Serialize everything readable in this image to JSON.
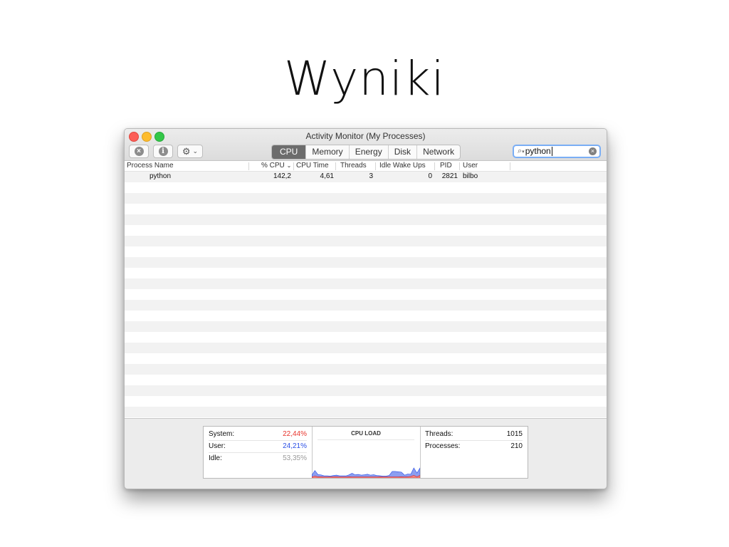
{
  "slide": {
    "title": "Wyniki"
  },
  "window": {
    "title": "Activity Monitor (My Processes)",
    "toolbar": {
      "stop_icon": "x-circle-icon",
      "info_icon": "info-icon",
      "gear_icon": "gear-icon",
      "tabs": [
        "CPU",
        "Memory",
        "Energy",
        "Disk",
        "Network"
      ],
      "active_tab": "CPU",
      "search_value": "python"
    },
    "table": {
      "headers": {
        "process_name": "Process Name",
        "cpu_pct": "% CPU",
        "cpu_time": "CPU Time",
        "threads": "Threads",
        "idle_wake_ups": "Idle Wake Ups",
        "pid": "PID",
        "user": "User"
      },
      "sort_column": "% CPU",
      "rows": [
        {
          "process_name": "python",
          "cpu_pct": "142,2",
          "cpu_time": "4,61",
          "threads": "3",
          "idle_wake_ups": "0",
          "pid": "2821",
          "user": "bilbo"
        }
      ]
    },
    "stats": {
      "system_label": "System:",
      "system_value": "22,44%",
      "system_color": "#e8342c",
      "user_label": "User:",
      "user_value": "24,21%",
      "user_color": "#2b4fe6",
      "idle_label": "Idle:",
      "idle_value": "53,35%",
      "idle_color": "#9a9a9a",
      "load_title": "CPU LOAD",
      "threads_label": "Threads:",
      "threads_value": "1015",
      "processes_label": "Processes:",
      "processes_value": "210"
    }
  },
  "chart_data": {
    "type": "area",
    "title": "CPU LOAD",
    "ylim": [
      0,
      100
    ],
    "series": [
      {
        "name": "System",
        "color": "#e8342c",
        "values": [
          5,
          10,
          6,
          6,
          5,
          5,
          5,
          6,
          6,
          5,
          5,
          5,
          6,
          5,
          5,
          5,
          5,
          5,
          5,
          5,
          5,
          5,
          6,
          5,
          5,
          5,
          5,
          5,
          5,
          6,
          5,
          6,
          8,
          14,
          6,
          14
        ]
      },
      {
        "name": "User",
        "color": "#2b4fe6",
        "values": [
          10,
          30,
          12,
          10,
          6,
          6,
          5,
          7,
          9,
          6,
          6,
          6,
          10,
          20,
          12,
          14,
          10,
          12,
          15,
          10,
          12,
          8,
          6,
          5,
          5,
          8,
          30,
          30,
          28,
          25,
          10,
          15,
          12,
          40,
          20,
          40
        ]
      }
    ]
  }
}
